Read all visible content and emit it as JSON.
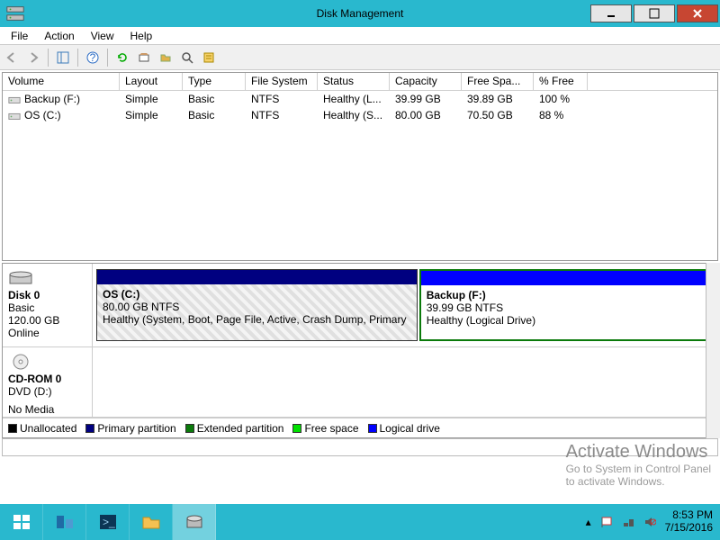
{
  "titlebar": {
    "title": "Disk Management"
  },
  "menu": {
    "file": "File",
    "action": "Action",
    "view": "View",
    "help": "Help"
  },
  "columns": {
    "volume": "Volume",
    "layout": "Layout",
    "type": "Type",
    "fs": "File System",
    "status": "Status",
    "capacity": "Capacity",
    "free": "Free Spa...",
    "pct": "% Free"
  },
  "volumes": [
    {
      "name": "Backup (F:)",
      "layout": "Simple",
      "type": "Basic",
      "fs": "NTFS",
      "status": "Healthy (L...",
      "capacity": "39.99 GB",
      "free": "39.89 GB",
      "pct": "100 %"
    },
    {
      "name": "OS (C:)",
      "layout": "Simple",
      "type": "Basic",
      "fs": "NTFS",
      "status": "Healthy (S...",
      "capacity": "80.00 GB",
      "free": "70.50 GB",
      "pct": "88 %"
    }
  ],
  "disk0": {
    "header_name": "Disk 0",
    "header_type": "Basic",
    "header_size": "120.00 GB",
    "header_state": "Online",
    "os_title": "OS  (C:)",
    "os_sub": "80.00 GB NTFS",
    "os_health": "Healthy (System, Boot, Page File, Active, Crash Dump, Primary",
    "bk_title": "Backup  (F:)",
    "bk_sub": "39.99 GB NTFS",
    "bk_health": "Healthy (Logical Drive)"
  },
  "cdrom": {
    "header_name": "CD-ROM 0",
    "header_sub": "DVD (D:)",
    "header_state": "No Media"
  },
  "legend": {
    "unalloc": "Unallocated",
    "primary": "Primary partition",
    "extended": "Extended partition",
    "freespace": "Free space",
    "logical": "Logical drive"
  },
  "watermark": {
    "title": "Activate Windows",
    "sub1": "Go to System in Control Panel",
    "sub2": "to activate Windows."
  },
  "tray": {
    "time": "8:53 PM",
    "date": "7/15/2016"
  }
}
